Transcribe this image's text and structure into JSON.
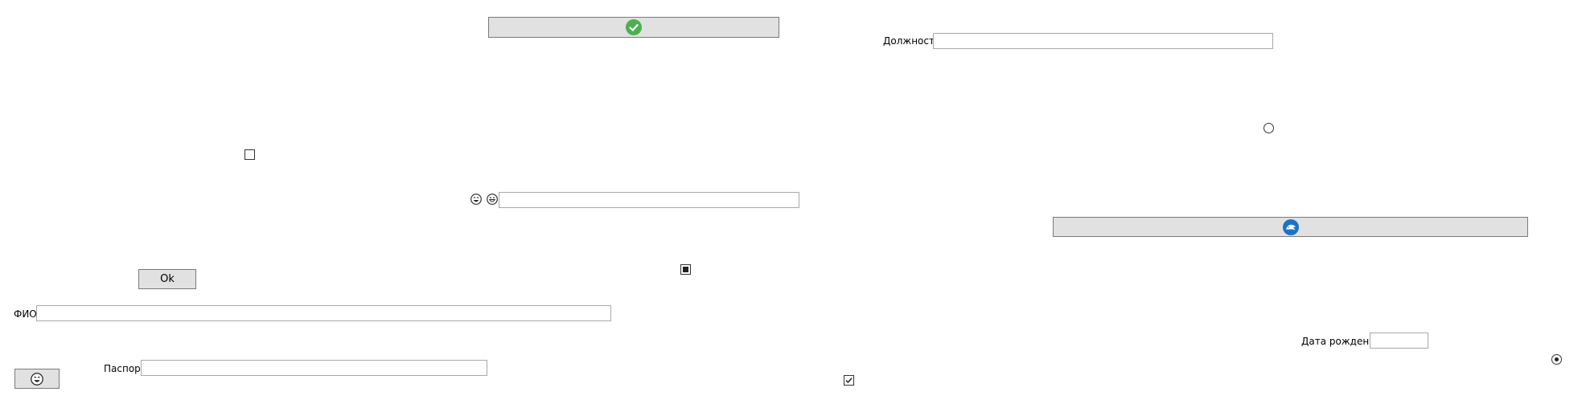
{
  "labels": {
    "position": "Должность",
    "full_name": "ФИО",
    "passport": "Паспорт",
    "birth_date": "Дата рождения"
  },
  "buttons": {
    "ok": "Ok"
  },
  "fields": {
    "position": "",
    "full_name": "",
    "passport": "",
    "birth_date": "",
    "emoji_field": ""
  },
  "icons": {
    "confirm": "check-circle-icon",
    "smiley_a": "smiley-face-icon",
    "smiley_b": "grin-face-icon",
    "bottom_button": "smiley-face-icon",
    "dolphin": "dolphin-icon"
  },
  "states": {
    "top_checkbox": false,
    "mid_checkbox": "indeterminate",
    "bottom_checkbox": true,
    "top_radio": false,
    "bottom_radio": true
  },
  "colors": {
    "button_bg": "#e1e1e1",
    "check_green": "#4cb050",
    "dolphin_blue": "#1a73c9"
  }
}
